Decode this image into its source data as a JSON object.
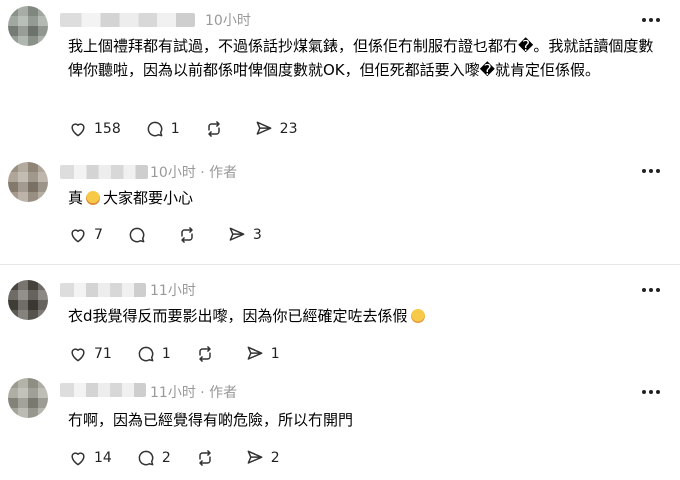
{
  "posts": [
    {
      "time": "10小时",
      "author_tag": "",
      "body": "我上個禮拜都有試過，不過係話抄煤氣錶，但係佢冇制服冇證乜都冇�。我就話讀個度數俾你聽啦，因為以前都係咁俾個度數就OK，但佢死都話要入嚟�就肯定佢係假。",
      "likes": "158",
      "replies": "1",
      "reposts": "",
      "shares": "23"
    },
    {
      "time": "10小时 · 作者",
      "body_pre": "真",
      "emoji": "crying-face",
      "body_post": "大家都要小心",
      "likes": "7",
      "replies": "",
      "reposts": "",
      "shares": "3"
    },
    {
      "time": "11小时",
      "body_pre": "衣d我覺得反而要影出嚟，因為你已經確定咗去係假",
      "emoji": "relieved-face",
      "likes": "71",
      "replies": "1",
      "reposts": "",
      "shares": "1"
    },
    {
      "time": "11小时 · 作者",
      "body": "冇啊，因為已經覺得有啲危險，所以冇開門",
      "likes": "14",
      "replies": "2",
      "reposts": "",
      "shares": "2"
    }
  ],
  "icons": {
    "like": "heart-icon",
    "reply": "comment-icon",
    "repost": "repost-icon",
    "share": "send-icon",
    "more": "more-icon"
  }
}
